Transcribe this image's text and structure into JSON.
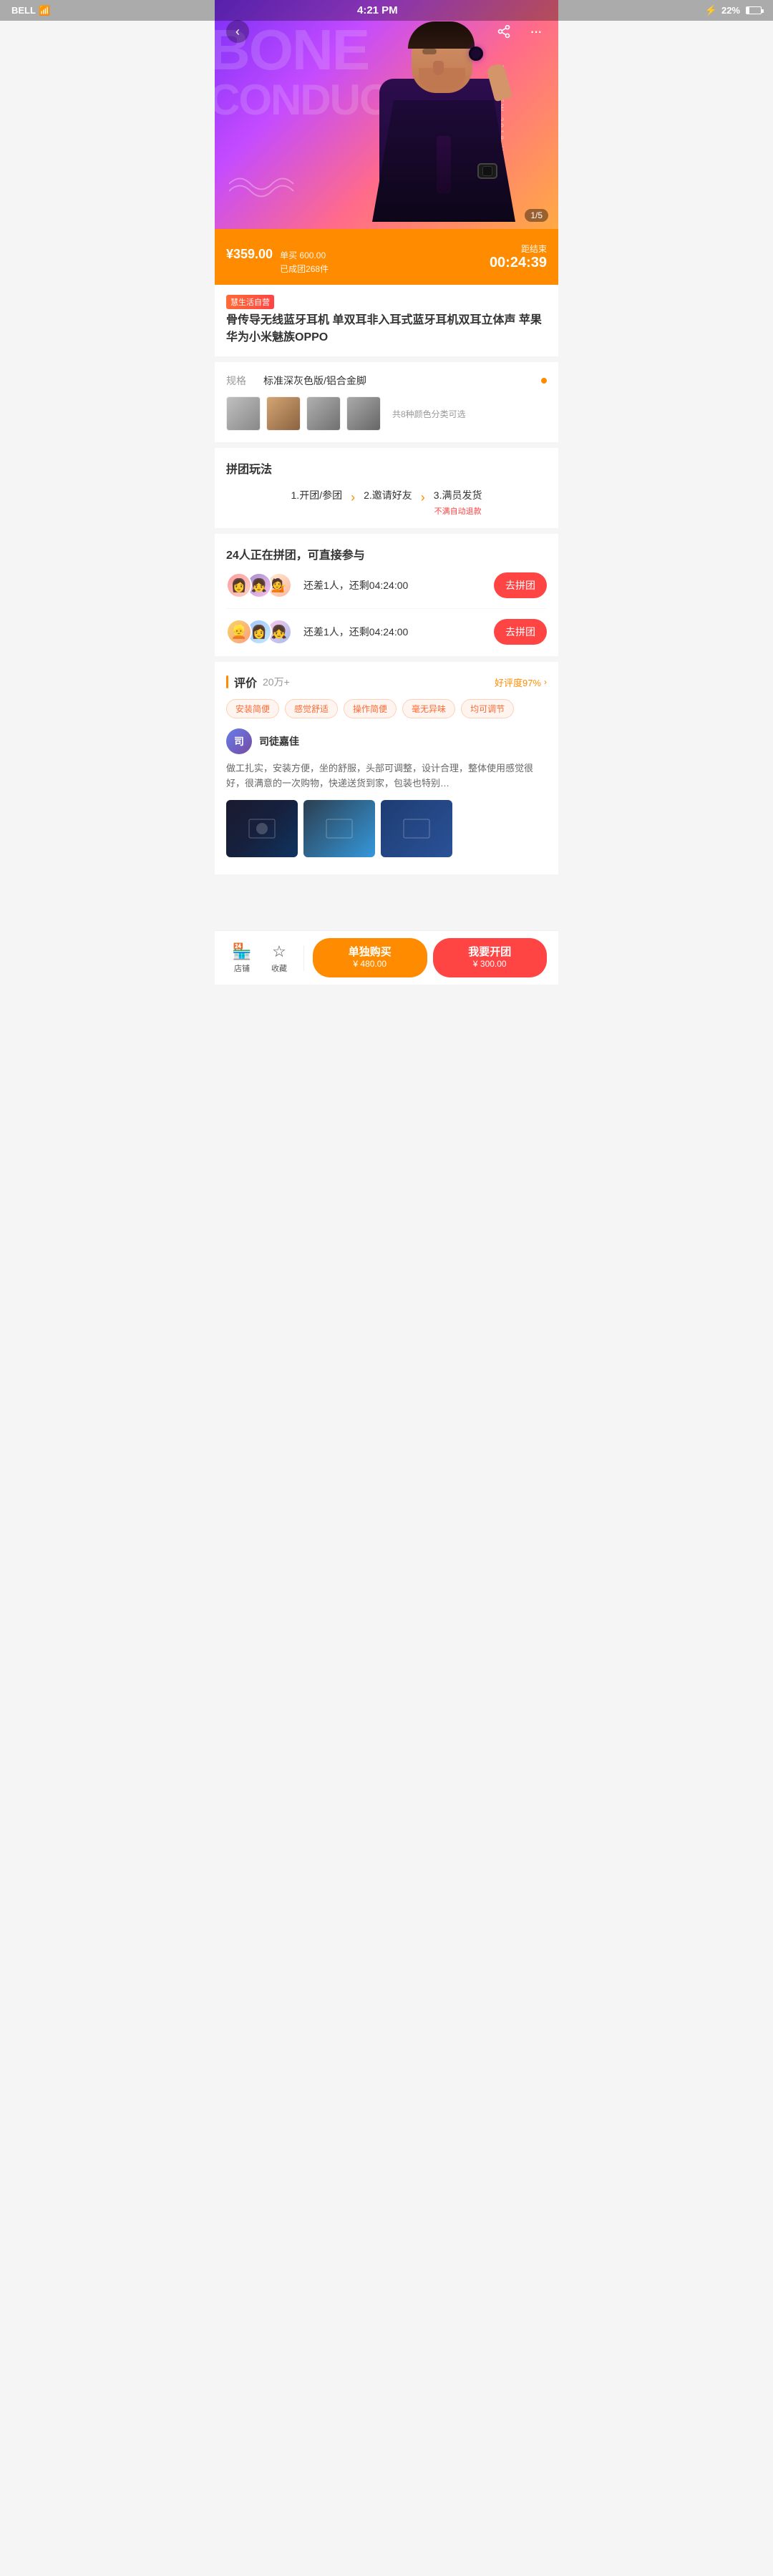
{
  "statusBar": {
    "carrier": "BELL",
    "time": "4:21 PM",
    "battery": "22%",
    "wifi": true,
    "bluetooth": true
  },
  "hero": {
    "bgTextLine1": "BONE",
    "bgTextLine2": "CONDUCT",
    "sideText": "THE NEW 2018 HIT",
    "pageIndicator": "1/5"
  },
  "nav": {
    "backLabel": "‹",
    "shareLabel": "⬆",
    "moreLabel": "···"
  },
  "price": {
    "currency": "¥",
    "current": "359.00",
    "original": "单买 600.00",
    "sold": "已成团268件",
    "countdownLabel": "距结束",
    "countdown": "00:24:39"
  },
  "productInfo": {
    "storeBadge": "慧生活自营",
    "title": "骨传导无线蓝牙耳机 单双耳非入耳式蓝牙耳机双耳立体声 苹果华为小米魅族OPPO"
  },
  "specs": {
    "label": "规格",
    "value": "标准深灰色版/铝合金脚",
    "colorMoreText": "共8种颜色分类可选",
    "thumbs": [
      {
        "id": "thumb1",
        "class": "thumb1"
      },
      {
        "id": "thumb2",
        "class": "thumb2"
      },
      {
        "id": "thumb3",
        "class": "thumb3"
      },
      {
        "id": "thumb4",
        "class": "thumb4"
      }
    ]
  },
  "groupBuy": {
    "sectionTitle": "拼团玩法",
    "step1": "1.开团/参团",
    "step2": "2.邀请好友",
    "step3": "3.满员发货",
    "stepSub": "不满自动退款"
  },
  "activeGroups": {
    "title": "24人正在拼团，可直接参与",
    "groups": [
      {
        "id": "group1",
        "infoText": "还差1人，还剩04:24:00",
        "btnLabel": "去拼团"
      },
      {
        "id": "group2",
        "infoText": "还差1人，还剩04:24:00",
        "btnLabel": "去拼团"
      }
    ]
  },
  "reviews": {
    "sectionTitle": "评价",
    "count": "20万+",
    "rateLabel": "好评度97%",
    "tags": [
      "安装简便",
      "感觉舒适",
      "操作简便",
      "毫无异味",
      "均可调节"
    ],
    "reviewer": {
      "name": "司徒嘉佳",
      "text": "做工扎实，安装方便，坐的舒服，头部可调整，设计合理，整体使用感觉很好，很满意的一次购物，快递送货到家，包装也特别…"
    },
    "arrowLabel": "›"
  },
  "bottomBar": {
    "storeLabel": "店铺",
    "collectLabel": "收藏",
    "soloBuyLabel": "单独购买",
    "soloBuyPrice": "¥ 480.00",
    "groupBuyLabel": "我要开团",
    "groupBuyPrice": "¥ 300.00"
  }
}
